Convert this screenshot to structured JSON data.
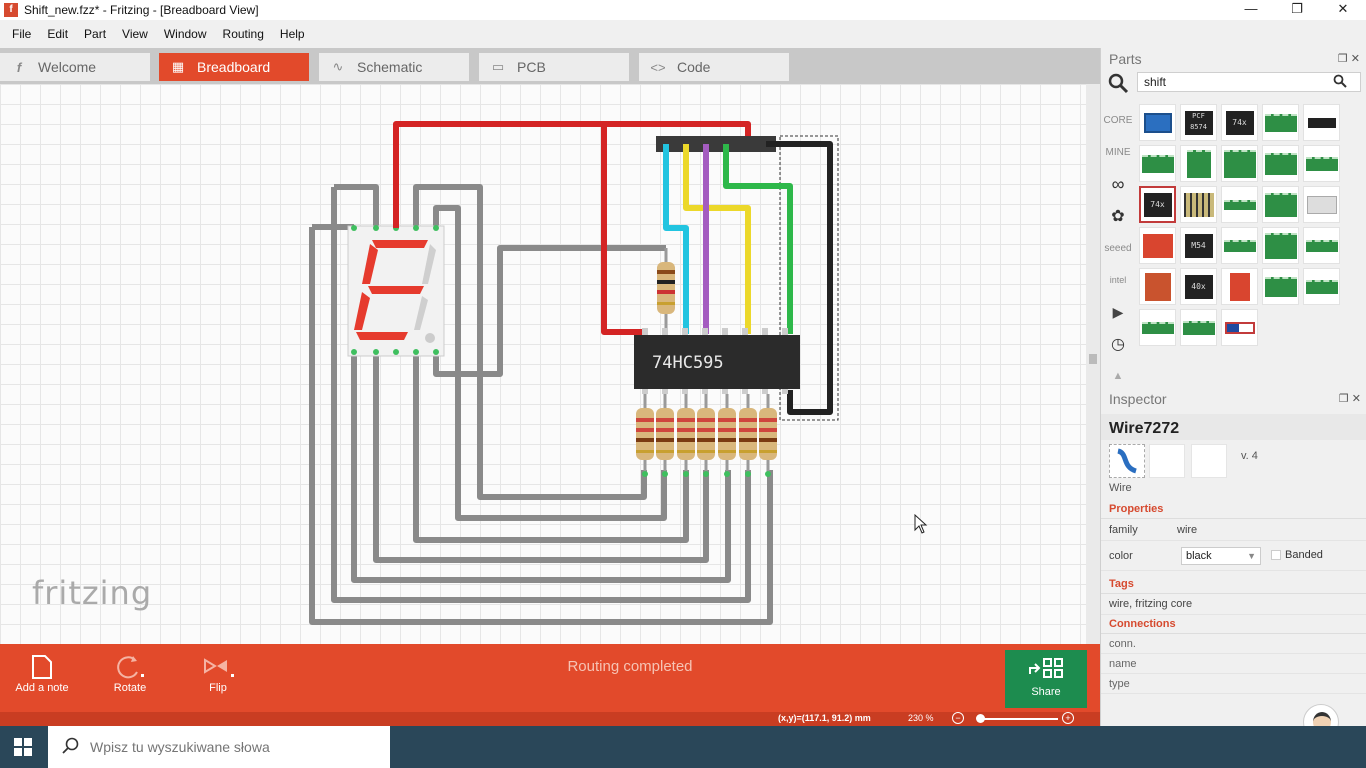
{
  "window": {
    "app_icon": "fritzing-icon",
    "title": "Shift_new.fzz* - Fritzing - [Breadboard View]",
    "controls": [
      "minimize",
      "maximize",
      "close"
    ]
  },
  "menu": [
    "File",
    "Edit",
    "Part",
    "View",
    "Window",
    "Routing",
    "Help"
  ],
  "tabs": [
    {
      "label": "Welcome",
      "icon": "fritzing-f-icon",
      "active": false
    },
    {
      "label": "Breadboard",
      "icon": "breadboard-icon",
      "active": true
    },
    {
      "label": "Schematic",
      "icon": "schematic-icon",
      "active": false
    },
    {
      "label": "PCB",
      "icon": "pcb-icon",
      "active": false
    },
    {
      "label": "Code",
      "icon": "code-icon",
      "active": false
    }
  ],
  "canvas": {
    "logo": "fritzing",
    "ic_label": "74HC595"
  },
  "toolbar": {
    "add_note": "Add a note",
    "rotate": "Rotate",
    "flip": "Flip",
    "status": "Routing completed",
    "share": "Share"
  },
  "statusbar": {
    "coords": "(x,y)=(117.1, 91.2) mm",
    "zoom": "230 %"
  },
  "parts": {
    "title": "Parts",
    "search_value": "shift",
    "bins": [
      "CORE",
      "MINE",
      "arduino-icon",
      "sparkfun-icon",
      "seeed",
      "intel-icon",
      "play-icon",
      "clock-icon",
      "scroll-up-icon"
    ],
    "grid_labels": [
      "PCF 8574",
      "74x",
      "74x",
      "M54",
      "40x"
    ]
  },
  "inspector": {
    "title": "Inspector",
    "selected_name": "Wire7272",
    "image_label": "Wire",
    "version": "v. 4",
    "properties_header": "Properties",
    "family_key": "family",
    "family_value": "wire",
    "color_key": "color",
    "color_value": "black",
    "banded_label": "Banded",
    "tags_header": "Tags",
    "tags_value": "wire, fritzing core",
    "connections_header": "Connections",
    "conn_rows": [
      "conn.",
      "name",
      "type"
    ]
  },
  "taskbar": {
    "search_placeholder": "Wpisz tu wyszukiwane słowa"
  },
  "colors": {
    "accent": "#e24a2b",
    "share_green": "#1d8c4f",
    "wire_red": "#d42424",
    "wire_black": "#222222",
    "wire_cyan": "#22c4e0",
    "wire_yellow": "#ecd82a",
    "wire_purple": "#a45cc0",
    "wire_green": "#2eb84a",
    "wire_gray": "#8a8a8a"
  }
}
